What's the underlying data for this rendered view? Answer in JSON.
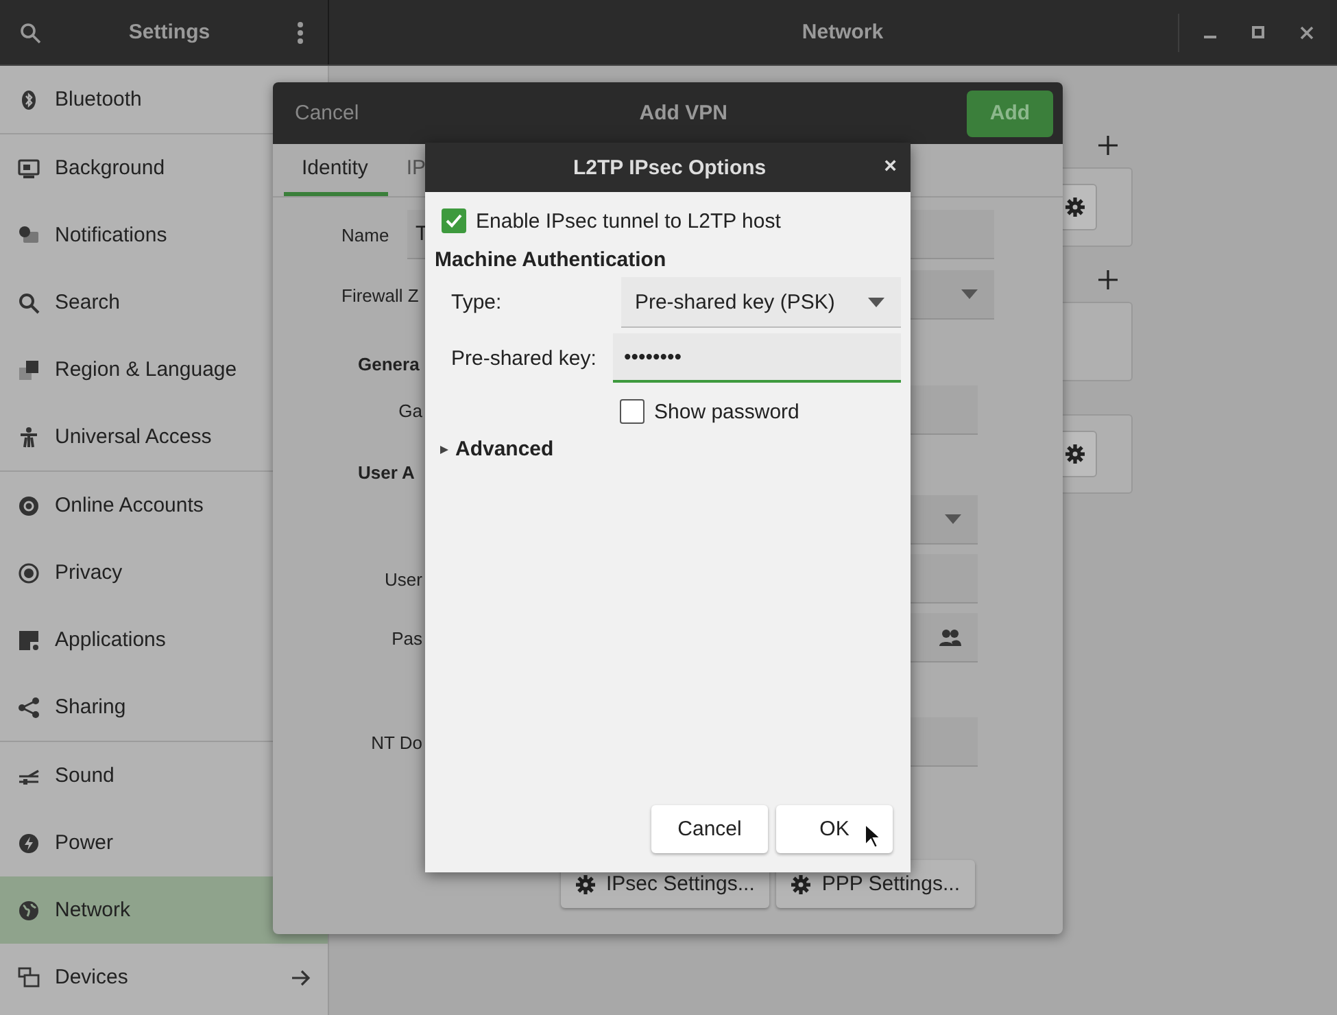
{
  "header": {
    "left_title": "Settings",
    "title": "Network"
  },
  "sidebar": {
    "items": [
      {
        "label": "Bluetooth",
        "selected": false
      },
      {
        "label": "Background",
        "selected": false
      },
      {
        "label": "Notifications",
        "selected": false
      },
      {
        "label": "Search",
        "selected": false
      },
      {
        "label": "Region & Language",
        "selected": false
      },
      {
        "label": "Universal Access",
        "selected": false
      },
      {
        "label": "Online Accounts",
        "selected": false
      },
      {
        "label": "Privacy",
        "selected": false
      },
      {
        "label": "Applications",
        "selected": false
      },
      {
        "label": "Sharing",
        "selected": false
      },
      {
        "label": "Sound",
        "selected": false
      },
      {
        "label": "Power",
        "selected": false
      },
      {
        "label": "Network",
        "selected": true
      },
      {
        "label": "Devices",
        "selected": false
      }
    ]
  },
  "add_vpn_dialog": {
    "title": "Add VPN",
    "cancel": "Cancel",
    "add": "Add",
    "tabs": [
      {
        "label": "Identity",
        "selected": true
      },
      {
        "label": "IP",
        "selected": false
      }
    ],
    "rows": [
      {
        "kind": "field",
        "label": "Name",
        "value": "T"
      },
      {
        "kind": "dropdown",
        "label": "Firewall Z"
      },
      {
        "kind": "heading",
        "label": "Genera"
      },
      {
        "kind": "field",
        "label": "Ga"
      },
      {
        "kind": "heading",
        "label": "User A"
      },
      {
        "kind": "dropdown"
      },
      {
        "kind": "field",
        "label": "User"
      },
      {
        "kind": "password",
        "label": "Pas"
      },
      {
        "kind": "field",
        "label": "NT Do"
      }
    ],
    "buttons": [
      "IPsec Settings...",
      "PPP Settings..."
    ]
  },
  "l2tp_dialog": {
    "title": "L2TP IPsec Options",
    "close": "×",
    "enable_tunnel": {
      "label": "Enable IPsec tunnel to L2TP host",
      "checked": true
    },
    "section": "Machine Authentication",
    "type": {
      "label": "Type:",
      "value": "Pre-shared key (PSK)"
    },
    "key": {
      "label": "Pre-shared key:",
      "value": "••••••••"
    },
    "show_password": {
      "label": "Show password",
      "checked": false
    },
    "advanced": {
      "label": "Advanced",
      "expanded": false
    },
    "buttons": [
      "Cancel",
      "OK"
    ]
  }
}
